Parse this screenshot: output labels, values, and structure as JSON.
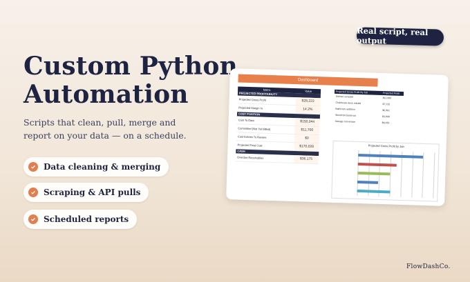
{
  "hero": {
    "title_line1": "Custom Python",
    "title_line2": "Automation",
    "subtitle": "Scripts that clean, pull, merge and report on your data — on a schedule."
  },
  "features": [
    {
      "label": "Data cleaning & merging"
    },
    {
      "label": "Scraping & API pulls"
    },
    {
      "label": "Scheduled reports"
    }
  ],
  "badge": "Real script, real output",
  "brand": "FlowDashCo.",
  "dashboard": {
    "title": "Dashboard",
    "metric_header": "Metric",
    "value_header": "Value",
    "section1": "PROJECTED PROFITABILITY",
    "rows1": [
      {
        "metric": "Projected Gross Profit",
        "value": "$28,222"
      },
      {
        "metric": "Projected Margin %",
        "value": "14.2%"
      }
    ],
    "section2": "COST POSITION",
    "rows2": [
      {
        "metric": "Cost To Date",
        "value": "$150,044"
      },
      {
        "metric": "Committed (Not Yet Billed)",
        "value": "$11,700"
      },
      {
        "metric": "Cost Entries To Review",
        "value": "$0"
      },
      {
        "metric": "Projected Final Cost",
        "value": "$170,028"
      }
    ],
    "section3": "CASH",
    "rows3": [
      {
        "metric": "Overdue Receivables",
        "value": "$36,175"
      }
    ],
    "job_header": "Projected Gross Profit By Job",
    "job_value_header": "Projected Profit",
    "jobs": [
      {
        "name": "Kitchen remodel",
        "value": "$11,900"
      },
      {
        "name": "Clubhouse deck rebuild",
        "value": "$7,132"
      },
      {
        "name": "Bathroom addition",
        "value": "$5,991"
      },
      {
        "name": "Storefront build-out",
        "value": "$3,808"
      },
      {
        "name": "Garage conversion",
        "value": "$6,050"
      }
    ],
    "chart_title": "Projected Gross Profit by Job"
  },
  "chart_data": {
    "type": "bar",
    "title": "Projected Gross Profit by Job",
    "orientation": "horizontal",
    "categories": [
      "Kitchen remodel",
      "Clubhouse deck rebuild",
      "Bathroom addition",
      "Storefront build-out",
      "Garage conversion"
    ],
    "values": [
      11900,
      7132,
      5991,
      3808,
      6050
    ],
    "colors": [
      "#4f81bd",
      "#c0504d",
      "#9bbb59",
      "#4f81bd",
      "#4bacc6"
    ],
    "xlim": [
      0,
      14000
    ],
    "grid": true
  },
  "colors": {
    "accent": "#e07f4f",
    "navy": "#1d2340"
  }
}
